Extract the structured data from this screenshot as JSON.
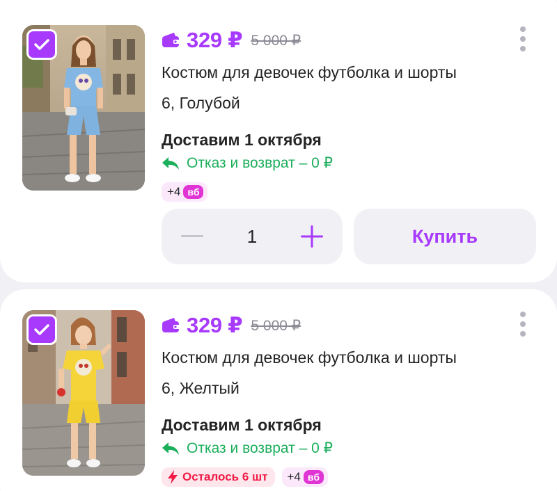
{
  "products": [
    {
      "price": "329 ₽",
      "old_price": "5 000 ₽",
      "title_line1": "Костюм для девочек футболка и шорты",
      "title_line2": "6, Голубой",
      "delivery": "Доставим 1 октября",
      "refund": "Отказ и возврат – 0 ₽",
      "bonus": "+4",
      "bonus_badge": "вб",
      "quantity": "1",
      "buy_label": "Купить",
      "selected": true,
      "product_color": "#7fb2df"
    },
    {
      "price": "329 ₽",
      "old_price": "5 000 ₽",
      "title_line1": "Костюм для девочек футболка и шорты",
      "title_line2": "6, Желтый",
      "delivery": "Доставим 1 октября",
      "refund": "Отказ и возврат – 0 ₽",
      "stock": "Осталось 6 шт",
      "bonus": "+4",
      "bonus_badge": "вб",
      "selected": true,
      "product_color": "#f5d43a"
    }
  ],
  "colors": {
    "accent": "#a73afd",
    "refund_green": "#1bae5b",
    "stock_red": "#f11b46",
    "bonus_pink": "#e034d4"
  },
  "icons": [
    "checkbox-checked-icon",
    "wallet-icon",
    "return-arrow-icon",
    "lightning-icon",
    "more-vertical-icon",
    "minus-icon",
    "plus-icon"
  ]
}
